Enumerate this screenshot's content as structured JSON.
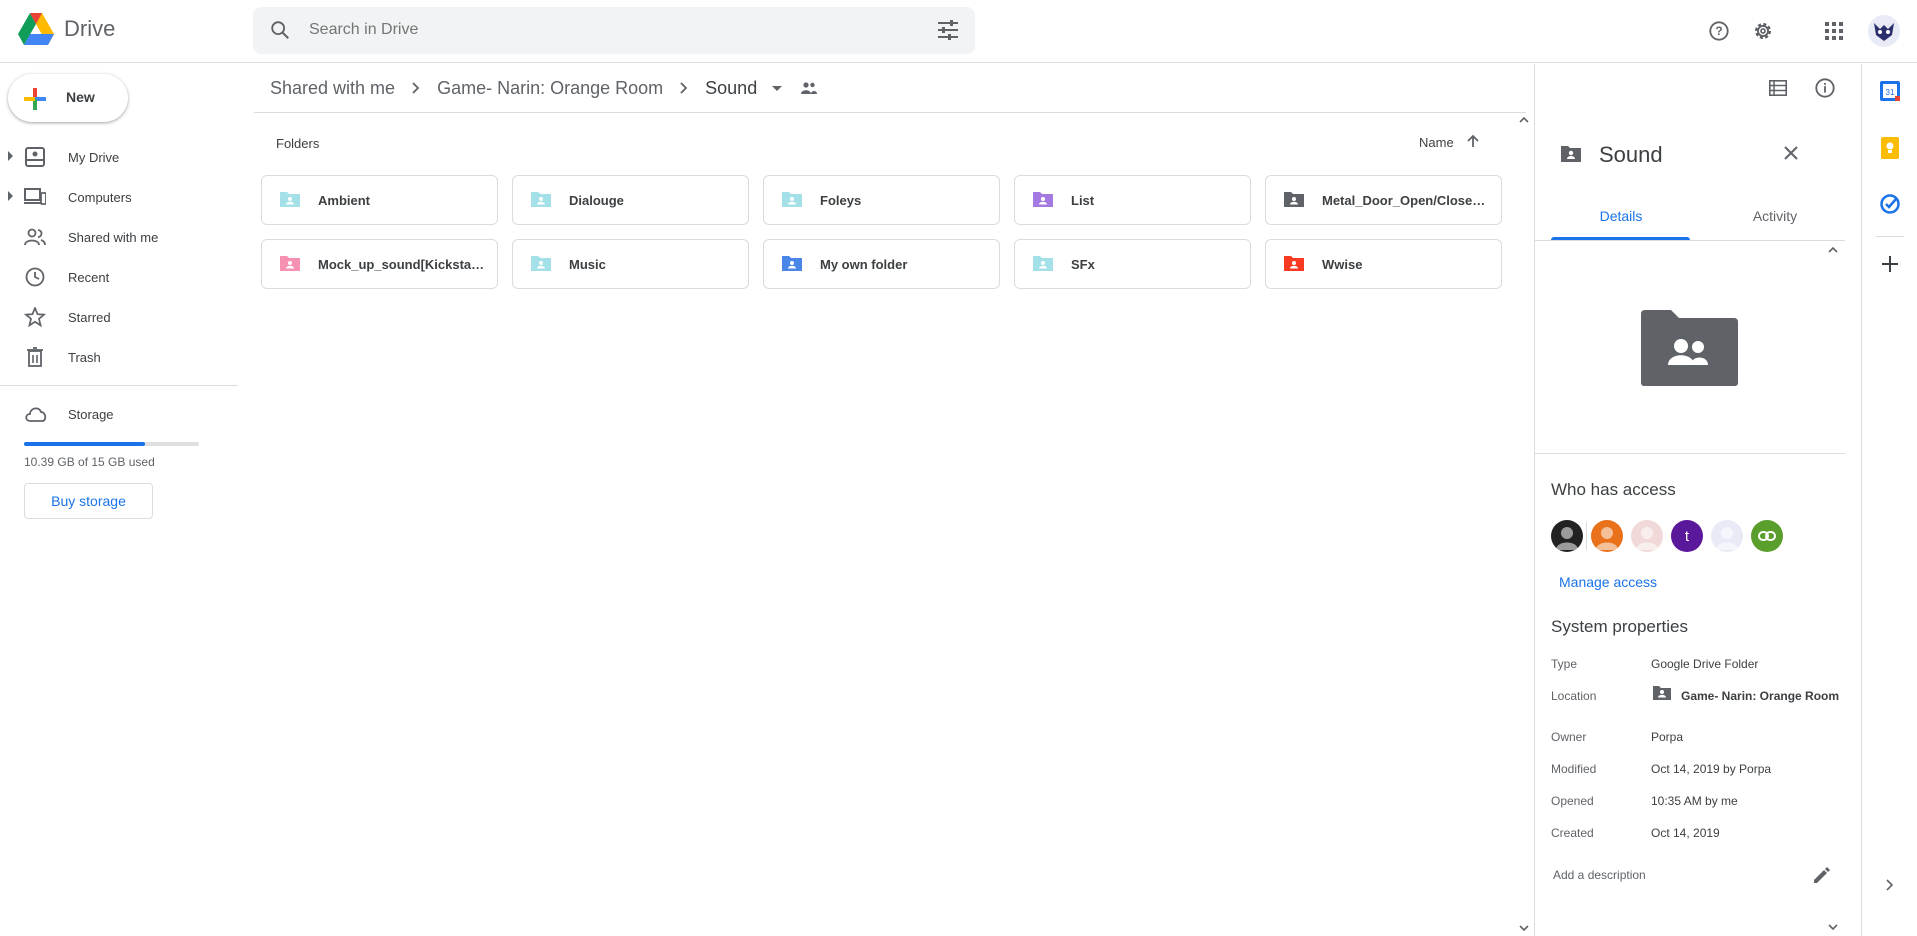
{
  "app": {
    "name": "Drive"
  },
  "search": {
    "placeholder": "Search in Drive"
  },
  "sidebar": {
    "new_label": "New",
    "items": [
      {
        "label": "My Drive"
      },
      {
        "label": "Computers"
      },
      {
        "label": "Shared with me"
      },
      {
        "label": "Recent"
      },
      {
        "label": "Starred"
      },
      {
        "label": "Trash"
      }
    ],
    "storage_label": "Storage",
    "storage_used_text": "10.39 GB of 15 GB used",
    "storage_fraction": 0.693,
    "buy_label": "Buy storage"
  },
  "breadcrumb": {
    "items": [
      "Shared with me",
      "Game- Narin: Orange Room"
    ],
    "current": "Sound"
  },
  "main": {
    "folders_label": "Folders",
    "sort_label": "Name",
    "folders": [
      {
        "name": "Ambient",
        "color": "#a4e0e8"
      },
      {
        "name": "Dialouge",
        "color": "#a4e0e8"
      },
      {
        "name": "Foleys",
        "color": "#a4e0e8"
      },
      {
        "name": "List",
        "color": "#a479e2"
      },
      {
        "name": "Metal_Door_Open/Close_R...",
        "color": "#5f6368"
      },
      {
        "name": "Mock_up_sound[Kickstarter]",
        "color": "#f691b2"
      },
      {
        "name": "Music",
        "color": "#a4e0e8"
      },
      {
        "name": "My own folder",
        "color": "#4986e7"
      },
      {
        "name": "SFx",
        "color": "#a4e0e8"
      },
      {
        "name": "Wwise",
        "color": "#f83a22"
      }
    ]
  },
  "details": {
    "title": "Sound",
    "tabs": [
      "Details",
      "Activity"
    ],
    "who_has_access": "Who has access",
    "avatars": [
      {
        "initial": "",
        "color": "#222222"
      },
      {
        "initial": "",
        "color": "#e8711a"
      },
      {
        "initial": "",
        "color": "#f1d9d9"
      },
      {
        "initial": "t",
        "color": "#5a189a"
      },
      {
        "initial": "",
        "color": "#e8eaf6"
      },
      {
        "initial": "",
        "color": "#5a9e2c"
      }
    ],
    "manage_access": "Manage access",
    "system_properties": "System properties",
    "props": {
      "type_k": "Type",
      "type_v": "Google Drive Folder",
      "location_k": "Location",
      "location_v": "Game- Narin: Orange Room",
      "owner_k": "Owner",
      "owner_v": "Porpa",
      "modified_k": "Modified",
      "modified_v": "Oct 14, 2019 by Porpa",
      "opened_k": "Opened",
      "opened_v": "10:35 AM by me",
      "created_k": "Created",
      "created_v": "Oct 14, 2019"
    },
    "add_description": "Add a description"
  },
  "rail": {
    "calendar_day": "31"
  }
}
